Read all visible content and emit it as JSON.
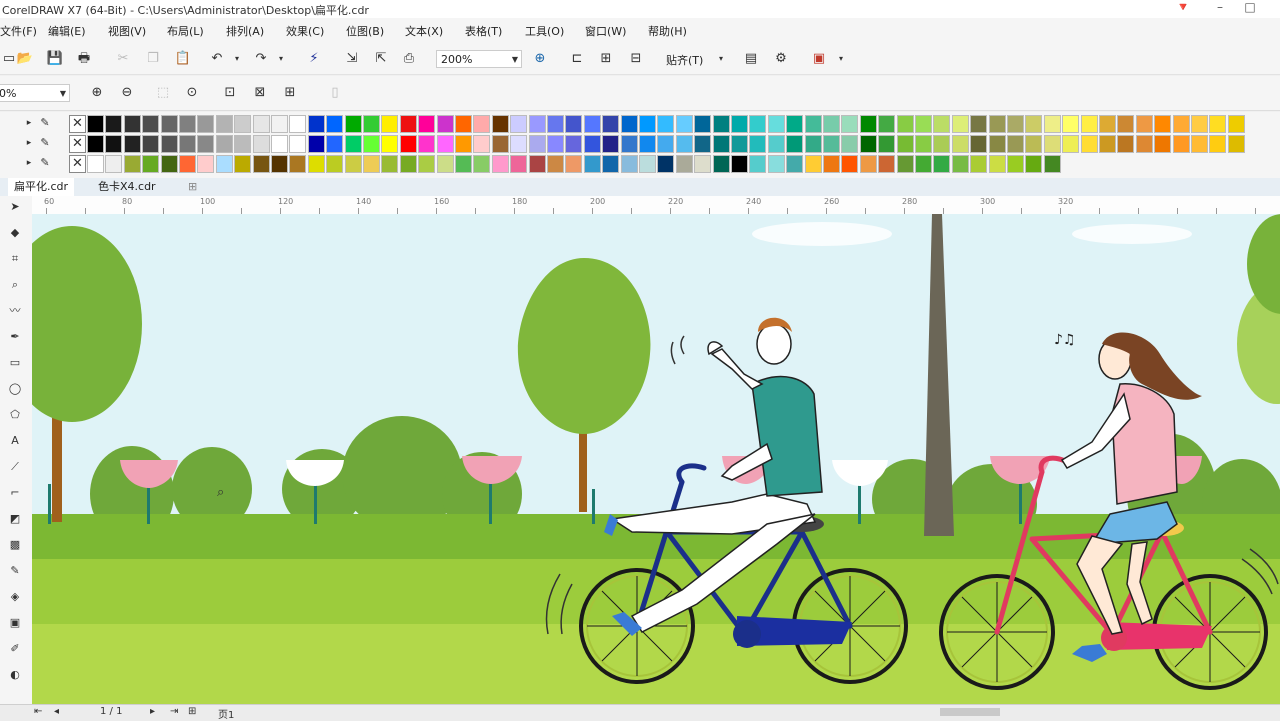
{
  "window": {
    "title": "CorelDRAW X7 (64-Bit) - C:\\Users\\Administrator\\Desktop\\扁平化.cdr",
    "controls": [
      "–",
      "□",
      "✕"
    ]
  },
  "menu": [
    "文件(F)",
    "编辑(E)",
    "视图(V)",
    "布局(L)",
    "排列(A)",
    "效果(C)",
    "位图(B)",
    "文本(X)",
    "表格(T)",
    "工具(O)",
    "窗口(W)",
    "帮助(H)"
  ],
  "toolbar": {
    "zoom_value": "200%",
    "snap_label": "贴齐(T)"
  },
  "propbar": {
    "zoom_percent": "0%"
  },
  "palette": {
    "rows": [
      [
        "#000000",
        "#1a1a1a",
        "#333333",
        "#4d4d4d",
        "#666666",
        "#808080",
        "#999999",
        "#b3b3b3",
        "#cccccc",
        "#e6e6e6",
        "#f2f2f2",
        "#ffffff",
        "#0033cc",
        "#0066ff",
        "#00aa00",
        "#33cc33",
        "#ffee00",
        "#ee1111",
        "#ff0099",
        "#cc33cc",
        "#ff6600",
        "#ffaaaa",
        "#663300",
        "#ccccff",
        "#9999ff",
        "#6677ee",
        "#4455cc",
        "#5577ff",
        "#3344aa",
        "#0066cc",
        "#0099ff",
        "#33bbff",
        "#66ccff",
        "#006699",
        "#008080",
        "#00aaaa",
        "#33cccc",
        "#66dddd",
        "#00aa88",
        "#44bb99",
        "#77ccaa",
        "#99ddbb",
        "#008800",
        "#44aa44",
        "#88cc44",
        "#99dd55",
        "#bbdd66",
        "#ddee77",
        "#777744",
        "#999955",
        "#aaaa66",
        "#cccc66",
        "#eeee88",
        "#ffff66",
        "#ffee44",
        "#ddaa33",
        "#cc8833",
        "#ee9944",
        "#ff8800",
        "#ffaa33",
        "#ffcc44",
        "#ffdd22",
        "#eecc00"
      ],
      [
        "#000000",
        "#111111",
        "#222222",
        "#444444",
        "#555555",
        "#777777",
        "#888888",
        "#aaaaaa",
        "#bbbbbb",
        "#dddddd",
        "#ffffff",
        "#ffffff",
        "#0000aa",
        "#2266ff",
        "#00cc66",
        "#66ff33",
        "#ffff00",
        "#ff0000",
        "#ff33cc",
        "#ff66ff",
        "#ff9900",
        "#ffcccc",
        "#996633",
        "#ddddff",
        "#aaaaee",
        "#8888ff",
        "#6666dd",
        "#3355dd",
        "#222288",
        "#3377cc",
        "#1188ee",
        "#44aaee",
        "#55bbee",
        "#116688",
        "#007777",
        "#119999",
        "#22bbbb",
        "#55cccc",
        "#009977",
        "#33aa88",
        "#55bb99",
        "#88ccaa",
        "#006600",
        "#339933",
        "#77bb33",
        "#88cc44",
        "#aacc55",
        "#ccdd66",
        "#666633",
        "#888844",
        "#999955",
        "#bbbb55",
        "#dddd77",
        "#eeee55",
        "#ffdd33",
        "#cc9922",
        "#bb7722",
        "#dd8833",
        "#ee7700",
        "#ff9922",
        "#ffbb33",
        "#ffcc11",
        "#ddbb00"
      ],
      [
        "#ffffff",
        "#eeeeee",
        "#99aa33",
        "#66aa22",
        "#446611",
        "#ff6633",
        "#ffcccc",
        "#aaddff",
        "#bbaa00",
        "#775511",
        "#553300",
        "#aa7722",
        "#dddd00",
        "#bbcc22",
        "#cccc44",
        "#eecc55",
        "#99bb33",
        "#77aa22",
        "#aacc44",
        "#ccdd88",
        "#55bb55",
        "#88cc66",
        "#ff99cc",
        "#ee6699",
        "#aa4444",
        "#cc8844",
        "#ee9966",
        "#3399cc",
        "#1166aa",
        "#88bbdd",
        "#bbdddd",
        "#003366",
        "#aaaa99",
        "#ddddcc",
        "#006655",
        "#000000",
        "#55cccc",
        "#88dddd",
        "#44aaaa",
        "#ffcc33",
        "#ee7711",
        "#ff5500",
        "#ee9944",
        "#cc6633",
        "#669933",
        "#44aa33",
        "#33aa44",
        "#77bb44",
        "#aacc33",
        "#ccdd44",
        "#99cc22",
        "#66aa11",
        "#448822"
      ]
    ]
  },
  "doc_tabs": [
    "扁平化.cdr",
    "色卡X4.cdr"
  ],
  "ruler": {
    "labels": [
      "60",
      "80",
      "100",
      "120",
      "140",
      "160",
      "180",
      "200",
      "220",
      "240",
      "260",
      "280",
      "300",
      "320"
    ]
  },
  "status": {
    "page_indicator": "1 / 1",
    "page_tab": "页1"
  }
}
